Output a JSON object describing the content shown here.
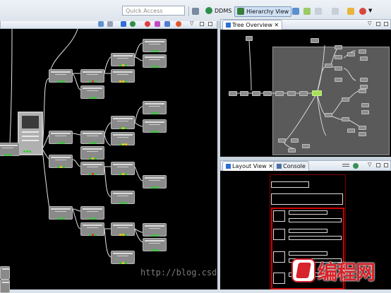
{
  "toolbar": {
    "quick_access_placeholder": "Quick Access",
    "ddms_label": "DDMS",
    "hierarchy_view_label": "Hierarchy View"
  },
  "tree_overview": {
    "tab_label": "Tree Overview",
    "close_glyph": "✕"
  },
  "layout_view": {
    "tab_label": "Layout View",
    "close_glyph": "✕"
  },
  "console": {
    "tab_label": "Console"
  },
  "watermark": {
    "text": "http://blog.csdn.net/"
  },
  "logo": {
    "text": "编程网"
  },
  "colors": {
    "canvas": "#000000",
    "node": "#8a8a8a",
    "selected": "#a8e05a",
    "layout_red": "#cc0000"
  }
}
